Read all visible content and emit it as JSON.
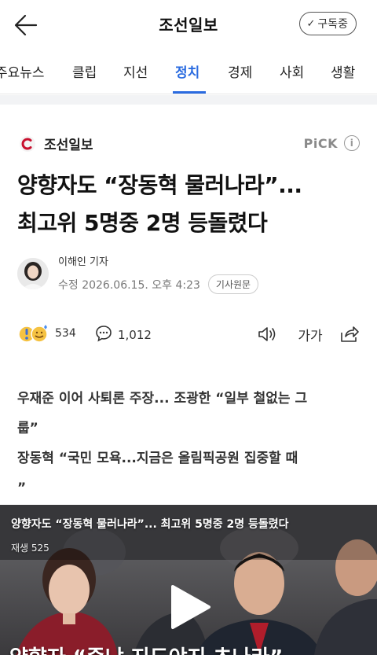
{
  "header": {
    "title": "조선일보",
    "subscribe_label": "구독중"
  },
  "tabs": [
    {
      "label": "주요뉴스"
    },
    {
      "label": "클립"
    },
    {
      "label": "지선"
    },
    {
      "label": "정치",
      "active": true
    },
    {
      "label": "경제"
    },
    {
      "label": "사회"
    },
    {
      "label": "생활"
    }
  ],
  "article": {
    "press_name": "조선일보",
    "pick_label": "PiCK",
    "headline_line1": "양향자도 “장동혁 물러나라”...",
    "headline_line2": "최고위 5명중 2명 등돌렸다",
    "reporter_name": "이해인 기자",
    "date": "수정 2026.06.15. 오후 4:23",
    "original_label": "기사원문",
    "reaction_count": "534",
    "comment_count": "1,012",
    "font_size_label": "가가",
    "summary_line1": "우재준 이어 사퇴론 주장... 조광한 “일부 철없는 그",
    "summary_line2": "룹”",
    "summary_line3": "장동혁 “국민 모욕...지금은 올림픽공원 집중할 때",
    "summary_line4": "”"
  },
  "video": {
    "title": "양향자도 “장동혁 물러나라”... 최고위 5명중 2명 등돌렸다",
    "plays": "재생 525",
    "caption": "양향자 “죽냐 지도야지 초나라”"
  },
  "colors": {
    "accent": "#2a6be0",
    "brand_red": "#c8102e"
  },
  "icons": [
    "back-arrow-icon",
    "check-icon",
    "info-icon",
    "comment-icon",
    "speaker-icon",
    "share-icon",
    "play-icon"
  ]
}
